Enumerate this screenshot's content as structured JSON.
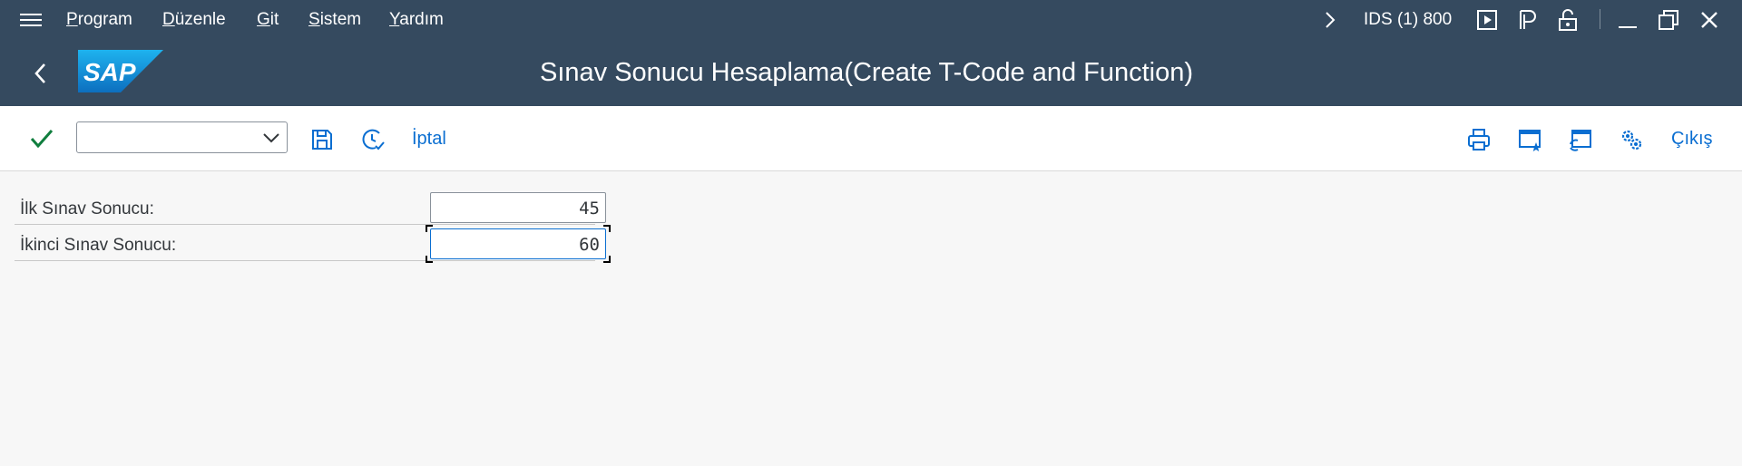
{
  "menubar": {
    "items": [
      {
        "label": "Program",
        "key": "P",
        "rest": "rogram"
      },
      {
        "label": "Düzenle",
        "key": "D",
        "rest": "üzenle"
      },
      {
        "label": "Git",
        "key": "G",
        "rest": "it"
      },
      {
        "label": "Sistem",
        "key": "S",
        "rest": "istem"
      },
      {
        "label": "Yardım",
        "key": "Y",
        "rest": "ardım"
      }
    ],
    "system_label": "IDS (1) 800"
  },
  "header": {
    "title": "Sınav Sonucu Hesaplama(Create T-Code and Function)",
    "logo_text": "SAP"
  },
  "toolbar": {
    "command_field_value": "",
    "cancel_label": "İptal",
    "exit_label": "Çıkış"
  },
  "form": {
    "first_exam_label": "İlk Sınav Sonucu:",
    "first_exam_value": "45",
    "second_exam_label": "İkinci Sınav Sonucu:",
    "second_exam_value": "60"
  },
  "colors": {
    "shell": "#354a5f",
    "accent": "#0a6ed1",
    "ok_green": "#107e3e",
    "background": "#f7f7f7"
  },
  "icons": [
    "menu-icon",
    "chevron-right-icon",
    "play-icon",
    "sap-p-icon",
    "lock-icon",
    "minimize-icon",
    "maximize-icon",
    "close-icon",
    "back-icon",
    "checkmark-icon",
    "save-icon",
    "clock-check-icon",
    "print-icon",
    "new-window-icon",
    "window-refresh-icon",
    "settings-icon"
  ]
}
